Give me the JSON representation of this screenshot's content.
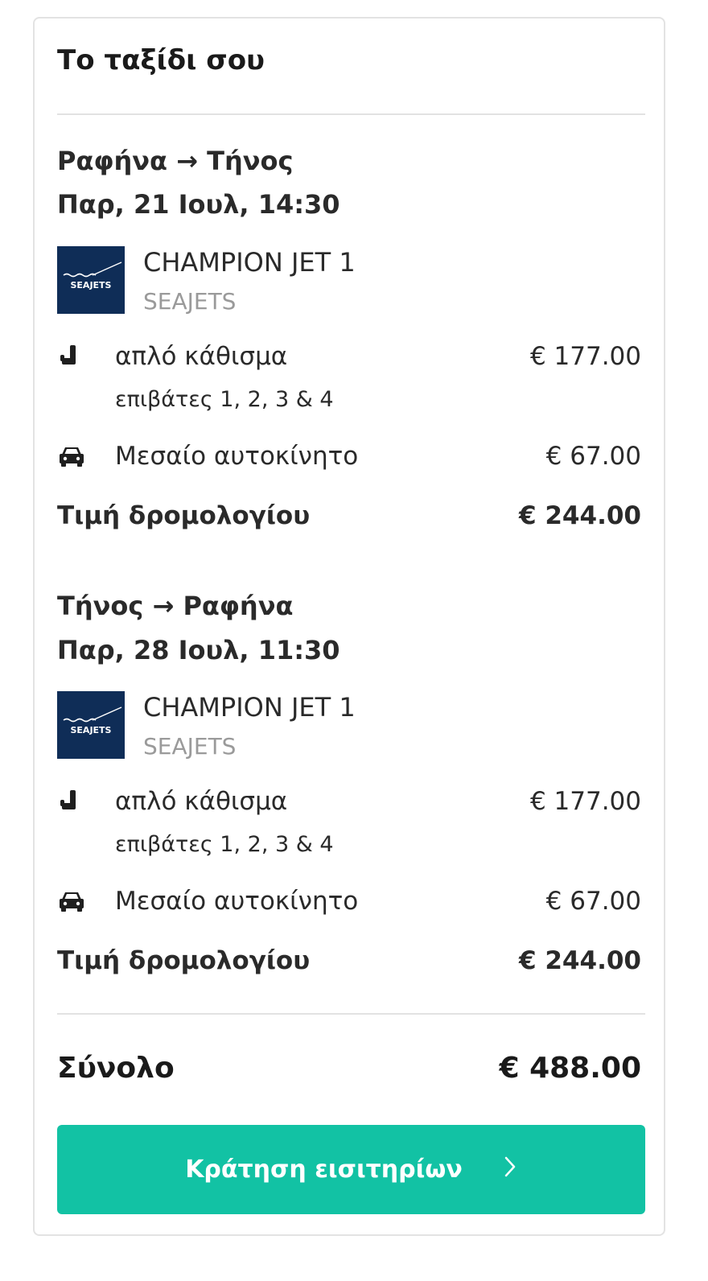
{
  "summary": {
    "title": "Το ταξίδι σου",
    "legs": [
      {
        "route": "Ραφήνα → Τήνος",
        "datetime": "Παρ, 21 Ιουλ, 14:30",
        "vessel": "CHAMPION JET 1",
        "operator": "SEAJETS",
        "logo_text": "SEAJETS",
        "logo_color": "#0f2d57",
        "items": [
          {
            "icon": "seat-icon",
            "label": "απλό κάθισμα",
            "sub": "επιβάτες 1, 2, 3 & 4",
            "price": "€ 177.00"
          },
          {
            "icon": "car-icon",
            "label": "Μεσαίο αυτοκίνητο",
            "price": "€ 67.00"
          }
        ],
        "total_label": "Τιμή δρομολογίου",
        "total": "€ 244.00"
      },
      {
        "route": "Τήνος → Ραφήνα",
        "datetime": "Παρ, 28 Ιουλ, 11:30",
        "vessel": "CHAMPION JET 1",
        "operator": "SEAJETS",
        "logo_text": "SEAJETS",
        "logo_color": "#0f2d57",
        "items": [
          {
            "icon": "seat-icon",
            "label": "απλό κάθισμα",
            "sub": "επιβάτες 1, 2, 3 & 4",
            "price": "€ 177.00"
          },
          {
            "icon": "car-icon",
            "label": "Μεσαίο αυτοκίνητο",
            "price": "€ 67.00"
          }
        ],
        "total_label": "Τιμή δρομολογίου",
        "total": "€ 244.00"
      }
    ],
    "grand_total_label": "Σύνολο",
    "grand_total": "€ 488.00",
    "book_button": {
      "label": "Κράτηση εισιτηρίων",
      "icon": "chevron-right-icon"
    },
    "colors": {
      "accent": "#12c2a4",
      "logo_bg": "#0f2d57",
      "muted_text": "#9a9a9a"
    }
  }
}
